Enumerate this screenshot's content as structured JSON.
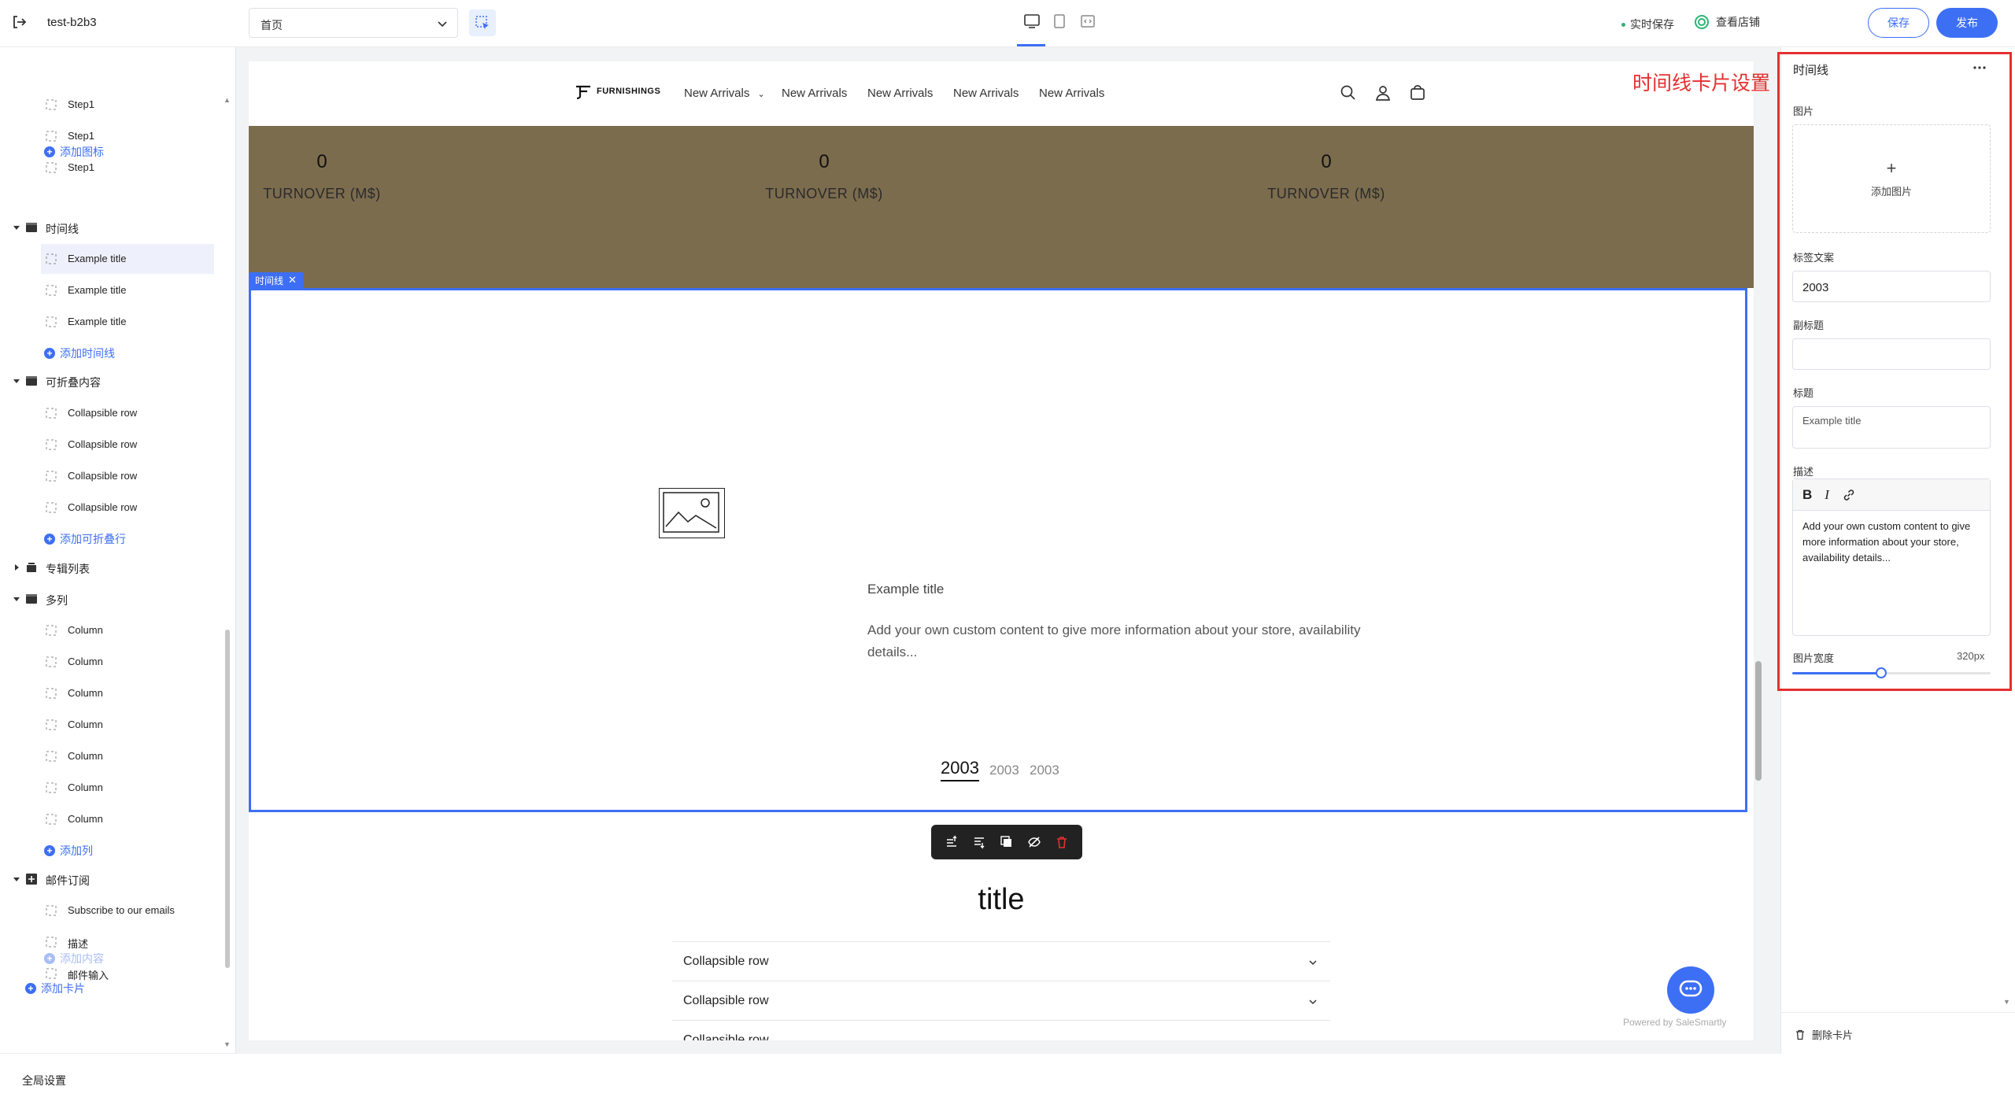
{
  "app": {
    "store_name": "test-b2b3",
    "page_select": "首页",
    "autosave": "实时保存",
    "view_store": "查看店铺",
    "save": "保存",
    "publish": "发布"
  },
  "tree": {
    "steps": [
      "Step1",
      "Step1",
      "Step1"
    ],
    "add_icon": "添加图标",
    "timeline_group": "时间线",
    "timeline_items": [
      "Example title",
      "Example title",
      "Example title"
    ],
    "add_timeline": "添加时间线",
    "collapsible_group": "可折叠内容",
    "collapsible_items": [
      "Collapsible row",
      "Collapsible row",
      "Collapsible row",
      "Collapsible row"
    ],
    "add_collapsible": "添加可折叠行",
    "album_group": "专辑列表",
    "multicolumn_group": "多列",
    "columns": [
      "Column",
      "Column",
      "Column",
      "Column",
      "Column",
      "Column",
      "Column"
    ],
    "add_column": "添加列",
    "newsletter_group": "邮件订阅",
    "newsletter_items": [
      "Subscribe to our emails",
      "描述",
      "邮件输入"
    ],
    "add_content": "添加内容",
    "add_card": "添加卡片",
    "global_settings": "全局设置"
  },
  "store": {
    "logo_text": "FURNISHINGS",
    "nav": [
      "New Arrivals",
      "New Arrivals",
      "New Arrivals",
      "New Arrivals",
      "New Arrivals"
    ],
    "stats": [
      {
        "num": "0",
        "label": "TURNOVER (M$)"
      },
      {
        "num": "0",
        "label": "TURNOVER (M$)"
      },
      {
        "num": "0",
        "label": "TURNOVER (M$)"
      }
    ],
    "section_tag": "时间线",
    "timeline": {
      "title": "Example title",
      "desc": "Add your own custom content to give more information about your store, availability details...",
      "years": [
        "2003",
        "2003",
        "2003"
      ]
    },
    "page_title": "title",
    "collapsible": [
      "Collapsible row",
      "Collapsible row",
      "Collapsible row"
    ],
    "powered": "Powered by SaleSmartly",
    "band_color": "#7c6c4e"
  },
  "panel": {
    "title": "时间线",
    "annotation": "时间线卡片设置",
    "image_label": "图片",
    "add_image": "添加图片",
    "tag_label": "标签文案",
    "tag_value": "2003",
    "subtitle_label": "副标题",
    "subtitle_value": "",
    "title_label": "标题",
    "title_value": "Example title",
    "desc_label": "描述",
    "desc_value": "Add your own custom content to give more information about your store, availability details...",
    "width_label": "图片宽度",
    "width_value": "320px",
    "width_fraction": 0.45,
    "delete_card": "删除卡片"
  },
  "colors": {
    "accent": "#3d6ff5",
    "annotation": "#e53030",
    "autosave_dot": "#2bb673"
  }
}
